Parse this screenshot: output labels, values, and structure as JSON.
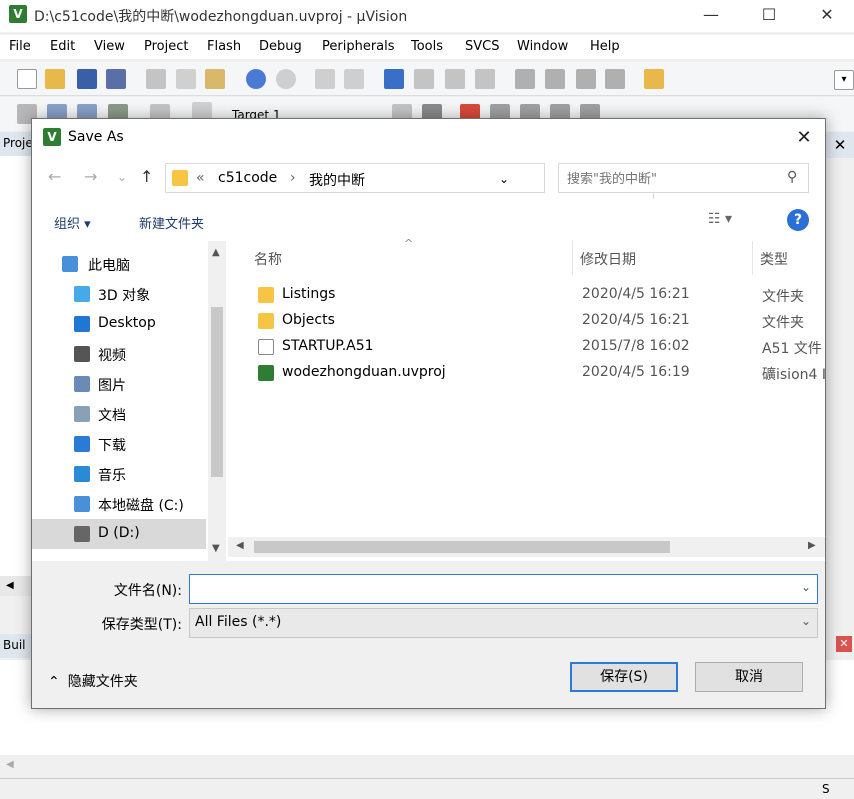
{
  "app": {
    "title": "D:\\c51code\\我的中断\\wodezhongduan.uvproj - µVision",
    "logo_glyph": "V",
    "window_controls": {
      "minimize": "—",
      "maximize": "☐",
      "close": "✕"
    },
    "menu": [
      "File",
      "Edit",
      "View",
      "Project",
      "Flash",
      "Debug",
      "Peripherals",
      "Tools",
      "SVCS",
      "Window",
      "Help"
    ],
    "target": "Target 1",
    "project_tab": "Proje",
    "build_tab": "Buil",
    "status_right": "S"
  },
  "dialog": {
    "title": "Save As",
    "close_glyph": "✕",
    "nav": {
      "back": "←",
      "forward": "→",
      "recent": "⌄",
      "up": "↑"
    },
    "address": {
      "prefix": "«",
      "parts": [
        "c51code",
        "我的中断"
      ],
      "separator": "›",
      "refresh": "↻"
    },
    "search": {
      "placeholder": "搜索\"我的中断\"",
      "icon": "⚲"
    },
    "commands": {
      "organize": "组织 ▾",
      "new_folder": "新建文件夹",
      "view": "☷ ▾",
      "help": "?"
    },
    "nav_pane": [
      {
        "label": "此电脑",
        "icon": "computer-icon",
        "color": "#4a90d9"
      },
      {
        "label": "3D 对象",
        "icon": "cube-icon",
        "color": "#47a9e8"
      },
      {
        "label": "Desktop",
        "icon": "desktop-icon",
        "color": "#1e78d2"
      },
      {
        "label": "视频",
        "icon": "video-icon",
        "color": "#555555"
      },
      {
        "label": "图片",
        "icon": "picture-icon",
        "color": "#6a8bb5"
      },
      {
        "label": "文档",
        "icon": "document-icon",
        "color": "#8aa0b8"
      },
      {
        "label": "下载",
        "icon": "download-icon",
        "color": "#2a7ad6"
      },
      {
        "label": "音乐",
        "icon": "music-icon",
        "color": "#2a8ad6"
      },
      {
        "label": "本地磁盘 (C:)",
        "icon": "disk-c-icon",
        "color": "#4a90d9"
      },
      {
        "label": "D (D:)",
        "icon": "disk-d-icon",
        "color": "#666666"
      }
    ],
    "columns": [
      "名称",
      "修改日期",
      "类型"
    ],
    "files": [
      {
        "name": "Listings",
        "date": "2020/4/5 16:21",
        "type": "文件夹",
        "icon": "folder-icon",
        "color": "#f6c544"
      },
      {
        "name": "Objects",
        "date": "2020/4/5 16:21",
        "type": "文件夹",
        "icon": "folder-icon",
        "color": "#f6c544"
      },
      {
        "name": "STARTUP.A51",
        "date": "2015/7/8 16:02",
        "type": "A51 文件",
        "icon": "file-icon",
        "color": "#ffffff"
      },
      {
        "name": "wodezhongduan.uvproj",
        "date": "2020/4/5 16:19",
        "type": "礦ision4 I",
        "icon": "uvision-icon",
        "color": "#2e7d32"
      }
    ],
    "filename_label": "文件名(N):",
    "filename_value": "",
    "filetype_label": "保存类型(T):",
    "filetype_value": "All Files (*.*)",
    "hide_folders": "隐藏文件夹",
    "save_label": "保存(S)",
    "cancel_label": "取消"
  }
}
